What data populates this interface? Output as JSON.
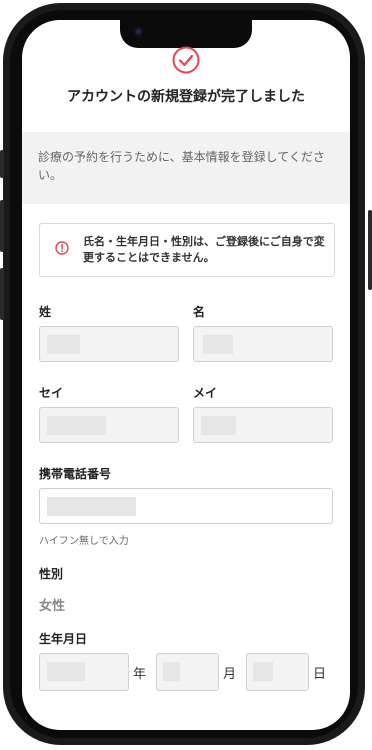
{
  "completion": {
    "title": "アカウントの新規登録が完了しました"
  },
  "info_band": {
    "text": "診療の予約を行うために、基本情報を登録してください。"
  },
  "notice": {
    "text": "氏名・生年月日・性別は、ご登録後にご自身で変更することはできません。"
  },
  "form": {
    "last_name_label": "姓",
    "first_name_label": "名",
    "last_name_kana_label": "セイ",
    "first_name_kana_label": "メイ",
    "phone_label": "携帯電話番号",
    "phone_hint": "ハイフン無しで入力",
    "gender_label": "性別",
    "gender_value": "女性",
    "birthdate_label": "生年月日",
    "year_unit": "年",
    "month_unit": "月",
    "day_unit": "日"
  },
  "colors": {
    "accent": "#e8434d",
    "info_band_bg": "#f2f2f2"
  },
  "icons": {
    "completion": "check-circle-icon",
    "notice": "exclamation-circle-icon"
  }
}
